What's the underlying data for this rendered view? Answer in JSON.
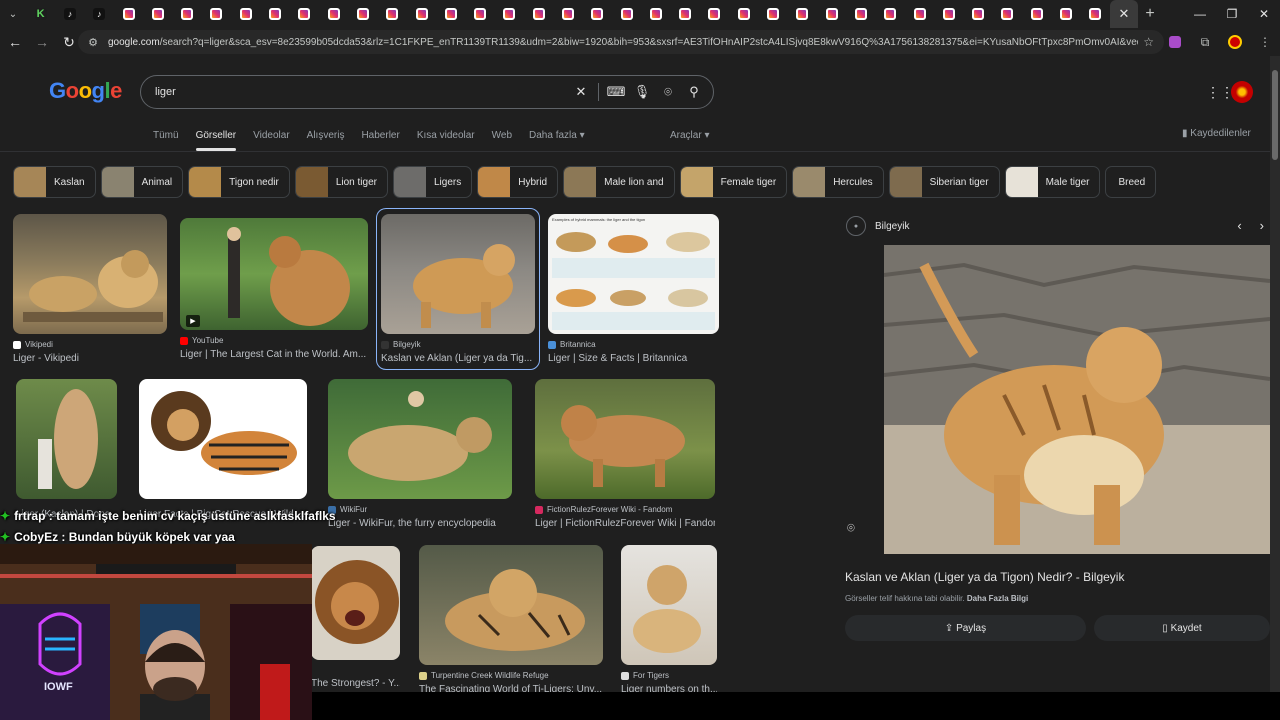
{
  "browser": {
    "url_host": "google.com",
    "url_rest": "/search?q=liger&sca_esv=8e23599b05dcda53&rlz=1C1FKPE_enTR1139TR1139&udm=2&biw=1920&bih=953&sxsrf=AE3TifOHnAIP2stcA4LISjvq8E8kwV916Q%3A1756138281375&ei=KYusaNbOFtTpxc8PmOmv0AI&ved=0ahUKEwiWh8Dz...",
    "tab_icons": [
      "k",
      "tt",
      "tt",
      "ig",
      "ig",
      "ig",
      "ig",
      "ig",
      "ig",
      "ig",
      "ig",
      "ig",
      "ig",
      "ig",
      "ig",
      "ig",
      "ig",
      "ig",
      "ig",
      "ig",
      "ig",
      "ig",
      "ig",
      "ig",
      "ig",
      "ig",
      "ig",
      "ig",
      "ig",
      "ig",
      "ig",
      "ig",
      "ig",
      "ig",
      "ig",
      "ig",
      "ig"
    ]
  },
  "search": {
    "logo": [
      "G",
      "o",
      "o",
      "g",
      "l",
      "e"
    ],
    "query": "liger"
  },
  "nav": {
    "tabs": [
      "Tümü",
      "Görseller",
      "Videolar",
      "Alışveriş",
      "Haberler",
      "Kısa videolar",
      "Web",
      "Daha fazla ▾"
    ],
    "tools": "Araçlar ▾",
    "saved": "Kaydedilenler"
  },
  "chips": [
    {
      "label": "Kaslan",
      "color": "#a68657"
    },
    {
      "label": "Animal",
      "color": "#8a8370"
    },
    {
      "label": "Tigon nedir",
      "color": "#b48a4a"
    },
    {
      "label": "Lion tiger",
      "color": "#7a5a32"
    },
    {
      "label": "Ligers",
      "color": "#6d6c6a"
    },
    {
      "label": "Hybrid",
      "color": "#c08848"
    },
    {
      "label": "Male lion and",
      "color": "#8c7856"
    },
    {
      "label": "Female tiger",
      "color": "#c4a46a"
    },
    {
      "label": "Hercules",
      "color": "#9a8a6c"
    },
    {
      "label": "Siberian tiger",
      "color": "#7e6b4e"
    },
    {
      "label": "Male tiger",
      "color": "#e7e2d8"
    },
    {
      "label": "Breed",
      "color": ""
    }
  ],
  "results": [
    {
      "source": "Vikipedi",
      "title": "Liger - Vikipedi",
      "fav": "#ffffff"
    },
    {
      "source": "YouTube",
      "title": "Liger | The Largest Cat in the World. Am...",
      "fav": "#ff0000"
    },
    {
      "source": "Bilgeyik",
      "title": "Kaslan ve Aklan (Liger ya da Tig...",
      "fav": "#333333"
    },
    {
      "source": "Britannica",
      "title": "Liger | Size & Facts | Britannica",
      "fav": "#4a90d9"
    },
    {
      "source": "",
      "title": "Liger (Kaslan) | Dona...",
      "fav": "#444"
    },
    {
      "source": "",
      "title": "Liger Facts | Big Cat Rescue | Wild ...",
      "fav": "#444"
    },
    {
      "source": "WikiFur",
      "title": "Liger - WikiFur, the furry encyclopedia",
      "fav": "#3a6ea5"
    },
    {
      "source": "FictionRulezForever Wiki - Fandom",
      "title": "Liger | FictionRulezForever Wiki | Fandom",
      "fav": "#d6295f"
    },
    {
      "source": "",
      "title": "The Strongest? - Y...",
      "fav": "#444"
    },
    {
      "source": "Turpentine Creek Wildlife Refuge",
      "title": "The Fascinating World of Ti-Ligers: Unv...",
      "fav": "#dcd08a"
    },
    {
      "source": "For Tigers",
      "title": "Liger numbers on th...",
      "fav": "#dddddd"
    }
  ],
  "britannica_chart_title": "Examples of hybrid mammals: the liger and the tigon",
  "panel": {
    "source": "Bilgeyik",
    "title": "Kaslan ve Aklan (Liger ya da Tigon) Nedir? - Bilgeyik",
    "copyright": "Görseller telif hakkına tabi olabilir.",
    "more_info": "Daha Fazla Bilgi",
    "share": "Paylaş",
    "save": "Kaydet"
  },
  "chat": [
    {
      "user": "frtrap",
      "message": "tamam işte benim cv kaçış üstüne aslkfasklfaflks"
    },
    {
      "user": "CobyEz",
      "message": "Bundan büyük köpek var yaa"
    }
  ],
  "webcam_sign": "IOWF"
}
